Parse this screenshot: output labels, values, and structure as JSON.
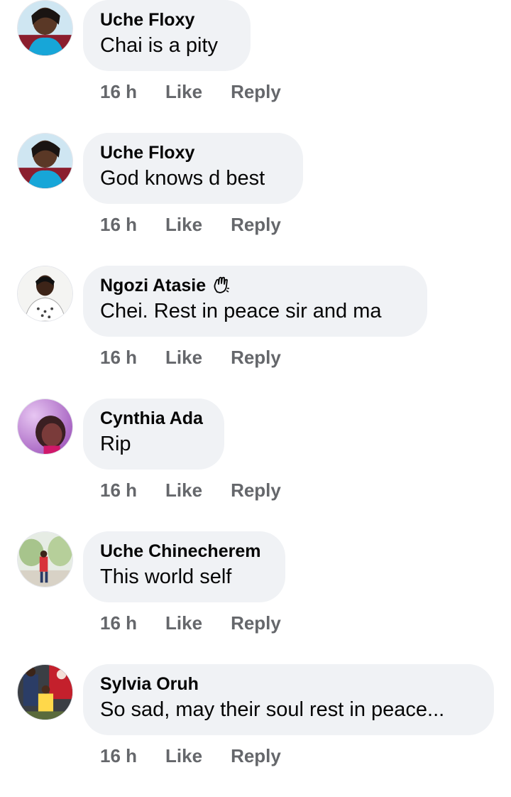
{
  "comments": [
    {
      "author": "Uche Floxy",
      "text": "Chai is a pity",
      "time": "16 h",
      "like": "Like",
      "reply": "Reply",
      "avatar": "avatar-blue-selfie"
    },
    {
      "author": "Uche Floxy",
      "text": "God knows d best",
      "time": "16 h",
      "like": "Like",
      "reply": "Reply",
      "avatar": "avatar-blue-selfie"
    },
    {
      "author": "Ngozi Atasie",
      "text": "Chei. Rest in peace sir and ma",
      "time": "16 h",
      "like": "Like",
      "reply": "Reply",
      "avatar": "avatar-white-dress",
      "badge": "wave-icon"
    },
    {
      "author": "Cynthia Ada",
      "text": "Rip",
      "time": "16 h",
      "like": "Like",
      "reply": "Reply",
      "avatar": "avatar-purple-portrait"
    },
    {
      "author": "Uche Chinecherem",
      "text": "This world self",
      "time": "16 h",
      "like": "Like",
      "reply": "Reply",
      "avatar": "avatar-outdoor-garden"
    },
    {
      "author": "Sylvia Oruh",
      "text": "So sad, may their soul rest in peace...",
      "time": "16 h",
      "like": "Like",
      "reply": "Reply",
      "avatar": "avatar-family-photo"
    }
  ],
  "colors": {
    "bubble": "#f0f2f5",
    "meta": "#65676b",
    "text": "#050505"
  }
}
